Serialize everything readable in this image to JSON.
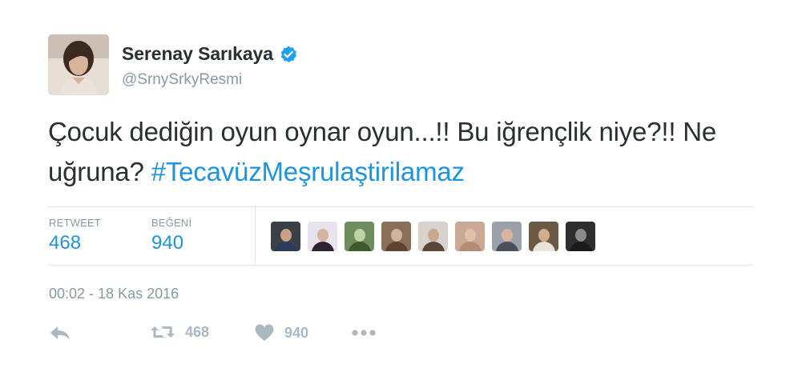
{
  "author": {
    "display_name": "Serenay Sarıkaya",
    "handle": "@SrnySrkyResmi",
    "verified": true,
    "avatar_icon": "profile-photo"
  },
  "tweet": {
    "text_plain": "Çocuk dediğin oyun oynar oyun...!! Bu iğrençlik niye?!! Ne uğruna? ",
    "hashtag": "#TecavüzMeşrulaştirilamaz",
    "timestamp": "00:02 - 18 Kas 2016"
  },
  "stats": {
    "retweets_label": "RETWEET",
    "retweets_value": "468",
    "likes_label": "BEĞENİ",
    "likes_value": "940"
  },
  "likers": [
    {
      "bg": "#3b4046",
      "skin": "#c9a184",
      "shirt": "#2b3b5a"
    },
    {
      "bg": "#e7e4ee",
      "skin": "#d7b39c",
      "shirt": "#2b2330"
    },
    {
      "bg": "#6f8c5c",
      "skin": "#bcd3a8",
      "shirt": "#3e5a2f"
    },
    {
      "bg": "#8a6f5a",
      "skin": "#d1b39a",
      "shirt": "#5d4332"
    },
    {
      "bg": "#d9d3cf",
      "skin": "#caa78f",
      "shirt": "#5a4639"
    },
    {
      "bg": "#c9a996",
      "skin": "#e0c0aa",
      "shirt": "#b48b74"
    },
    {
      "bg": "#9ca0a8",
      "skin": "#d9b49e",
      "shirt": "#4a4f5a"
    },
    {
      "bg": "#6a5a45",
      "skin": "#d2ad8d",
      "shirt": "#e8e3d8"
    },
    {
      "bg": "#2e2e2e",
      "skin": "#8b8b8b",
      "shirt": "#1b1b1b"
    }
  ],
  "actions": {
    "retweet_count": "468",
    "like_count": "940"
  },
  "colors": {
    "link": "#1b95e0",
    "secondary_text": "#8899a6",
    "action_icon": "#aab8c2",
    "divider": "#e1e8ed",
    "verified": "#1da1f2"
  }
}
